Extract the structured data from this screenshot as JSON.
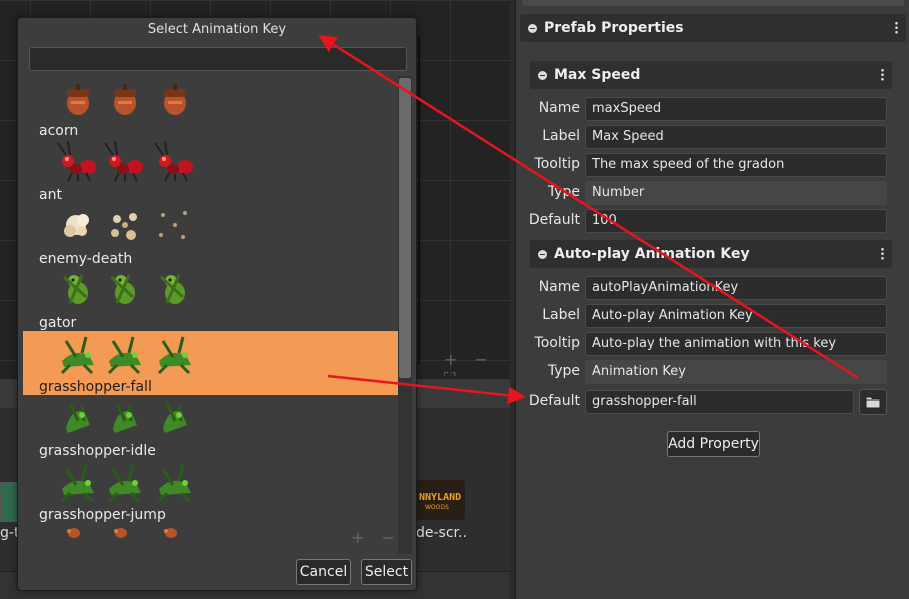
{
  "background": {
    "scene_controls": "+ − ⛶",
    "asset_left_label": "g-t",
    "asset_right_label": "de-scr..",
    "asset_right_logo_line1": "NNYLAND",
    "asset_right_logo_line2": "WOODS",
    "mini_controls": "+ −"
  },
  "dialog": {
    "title": "Select Animation Key",
    "search_value": "",
    "items": [
      {
        "name": "acorn",
        "selected": false,
        "sprite": "acorn"
      },
      {
        "name": "ant",
        "selected": false,
        "sprite": "ant"
      },
      {
        "name": "enemy-death",
        "selected": false,
        "sprite": "puff"
      },
      {
        "name": "gator",
        "selected": false,
        "sprite": "gator"
      },
      {
        "name": "grasshopper-fall",
        "selected": true,
        "sprite": "hopper"
      },
      {
        "name": "grasshopper-idle",
        "selected": false,
        "sprite": "hopper-idle"
      },
      {
        "name": "grasshopper-jump",
        "selected": false,
        "sprite": "hopper"
      },
      {
        "name": "",
        "selected": false,
        "sprite": "small"
      }
    ],
    "list_controls": "+ −",
    "cancel_label": "Cancel",
    "select_label": "Select"
  },
  "inspector": {
    "prefab_section_title": "Prefab Properties",
    "max_speed": {
      "title": "Max Speed",
      "name_label": "Name",
      "name_value": "maxSpeed",
      "label_label": "Label",
      "label_value": "Max Speed",
      "tooltip_label": "Tooltip",
      "tooltip_value": "The max speed of the gradon",
      "type_label": "Type",
      "type_value": "Number",
      "default_label": "Default",
      "default_value": "100"
    },
    "autoplay": {
      "title": "Auto-play Animation Key",
      "name_label": "Name",
      "name_value": "autoPlayAnimationKey",
      "label_label": "Label",
      "label_value": "Auto-play Animation Key",
      "tooltip_label": "Tooltip",
      "tooltip_value": "Auto-play the animation with this key",
      "type_label": "Type",
      "type_value": "Animation Key",
      "default_label": "Default",
      "default_value": "grasshopper-fall"
    },
    "add_property_label": "Add Property"
  },
  "colors": {
    "selection": "#f39a55",
    "annotation_arrow": "#e8141e"
  }
}
